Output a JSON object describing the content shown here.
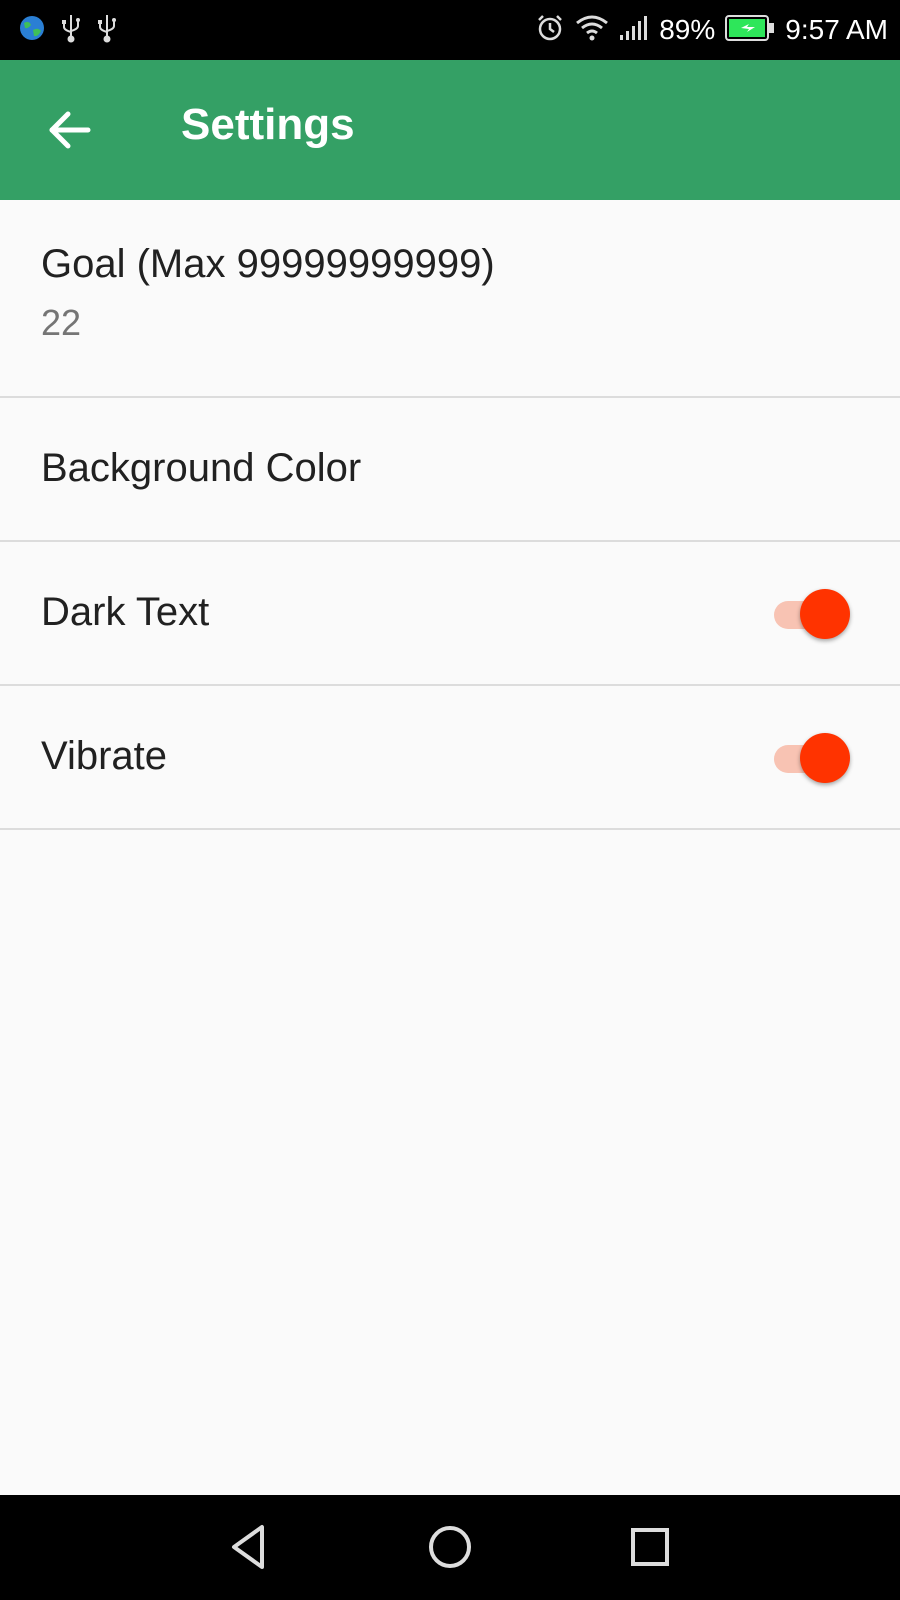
{
  "status_bar": {
    "battery_percent": "89%",
    "time": "9:57 AM",
    "icons": [
      "globe-icon",
      "usb-icon",
      "usb-icon",
      "alarm-icon",
      "wifi-icon",
      "signal-icon",
      "battery-charging-icon"
    ],
    "colors": {
      "background": "#000000",
      "battery_fill": "#2ee65a"
    }
  },
  "app_bar": {
    "title": "Settings",
    "back_icon": "arrow-left-icon",
    "color": "#34a065"
  },
  "settings": {
    "goal": {
      "title": "Goal (Max 99999999999)",
      "value": "22"
    },
    "background_color": {
      "title": "Background Color"
    },
    "dark_text": {
      "title": "Dark Text",
      "enabled": true
    },
    "vibrate": {
      "title": "Vibrate",
      "enabled": true
    },
    "switch_color": "#ff3300"
  },
  "nav_bar": {
    "buttons": [
      "back-triangle-icon",
      "home-circle-icon",
      "recents-square-icon"
    ]
  }
}
